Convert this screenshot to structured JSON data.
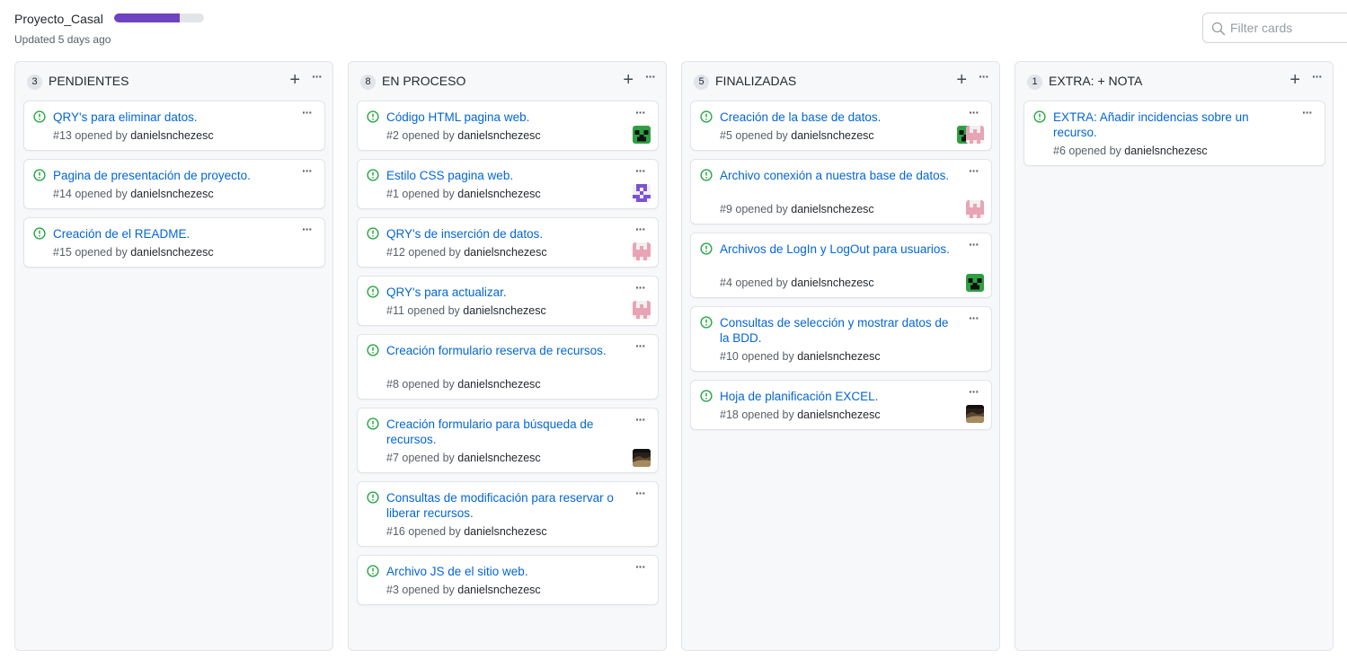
{
  "project": {
    "title": "Proyecto_Casal",
    "updated": "Updated 5 days ago",
    "progress_fraction": 0.73,
    "progress_color": "#6f42c1"
  },
  "filter": {
    "placeholder": "Filter cards",
    "value": ""
  },
  "colors": {
    "link": "#0366d6",
    "open_issue": "#28a745",
    "column_bg": "#f6f8fa"
  },
  "columns": [
    {
      "count": "3",
      "title": "PENDIENTES",
      "cards": [
        {
          "title": "QRY's para eliminar datos.",
          "number": "#13",
          "opened_by": "opened by",
          "author": "danielsnchezesc",
          "avatar": ""
        },
        {
          "title": "Pagina de presentación de proyecto.",
          "number": "#14",
          "opened_by": "opened by",
          "author": "danielsnchezesc",
          "avatar": ""
        },
        {
          "title": "Creación de el README.",
          "number": "#15",
          "opened_by": "opened by",
          "author": "danielsnchezesc",
          "avatar": ""
        }
      ]
    },
    {
      "count": "8",
      "title": "EN PROCESO",
      "cards": [
        {
          "title": "Código HTML pagina web.",
          "number": "#2",
          "opened_by": "opened by",
          "author": "danielsnchezesc",
          "avatar": "creeper"
        },
        {
          "title": "Estilo CSS pagina web.",
          "number": "#1",
          "opened_by": "opened by",
          "author": "danielsnchezesc",
          "avatar": "purple-identicon"
        },
        {
          "title": "QRY's de inserción de datos.",
          "number": "#12",
          "opened_by": "opened by",
          "author": "danielsnchezesc",
          "avatar": "pink-identicon"
        },
        {
          "title": "QRY's para actualizar.",
          "number": "#11",
          "opened_by": "opened by",
          "author": "danielsnchezesc",
          "avatar": "pink-identicon"
        },
        {
          "title": "Creación formulario reserva de recursos.",
          "number": "#8",
          "opened_by": "opened by",
          "author": "danielsnchezesc",
          "avatar": ""
        },
        {
          "title": "Creación formulario para búsqueda de recursos.",
          "number": "#7",
          "opened_by": "opened by",
          "author": "danielsnchezesc",
          "avatar": "photo"
        },
        {
          "title": "Consultas de modificación para reservar o liberar recursos.",
          "number": "#16",
          "opened_by": "opened by",
          "author": "danielsnchezesc",
          "avatar": ""
        },
        {
          "title": "Archivo JS de el sitio web.",
          "number": "#3",
          "opened_by": "opened by",
          "author": "danielsnchezesc",
          "avatar": ""
        }
      ]
    },
    {
      "count": "5",
      "title": "FINALIZADAS",
      "cards": [
        {
          "title": "Creación de la base de datos.",
          "number": "#5",
          "opened_by": "opened by",
          "author": "danielsnchezesc",
          "avatar": "creeper+pink-identicon"
        },
        {
          "title": "Archivo conexión a nuestra base de datos.",
          "number": "#9",
          "opened_by": "opened by",
          "author": "danielsnchezesc",
          "avatar": "pink-identicon"
        },
        {
          "title": "Archivos de LogIn y LogOut para usuarios.",
          "number": "#4",
          "opened_by": "opened by",
          "author": "danielsnchezesc",
          "avatar": "creeper"
        },
        {
          "title": "Consultas de selección y mostrar datos de la BDD.",
          "number": "#10",
          "opened_by": "opened by",
          "author": "danielsnchezesc",
          "avatar": ""
        },
        {
          "title": "Hoja de planificación EXCEL.",
          "number": "#18",
          "opened_by": "opened by",
          "author": "danielsnchezesc",
          "avatar": "photo"
        }
      ]
    },
    {
      "count": "1",
      "title": "EXTRA: + NOTA",
      "cards": [
        {
          "title": "EXTRA: Añadir incidencias sobre un recurso.",
          "number": "#6",
          "opened_by": "opened by",
          "author": "danielsnchezesc",
          "avatar": ""
        }
      ]
    }
  ]
}
